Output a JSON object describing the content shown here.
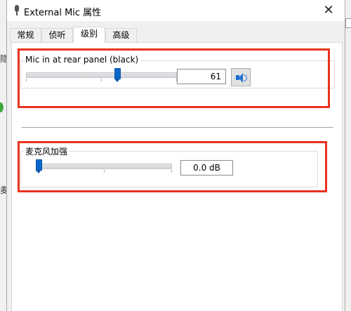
{
  "window": {
    "title": "External Mic 属性",
    "close_label": "✕"
  },
  "tabs": [
    {
      "label": "常规"
    },
    {
      "label": "侦听"
    },
    {
      "label": "级别"
    },
    {
      "label": "高级"
    }
  ],
  "active_tab": "级别",
  "mic_group": {
    "label": "Mic in at rear panel (black)",
    "value": "61",
    "level": 61
  },
  "boost_group": {
    "label": "麦克风加强",
    "value": "0.0 dB",
    "level": 0
  },
  "background": {
    "left_glyph": "隐",
    "left_glyph_2": "麦"
  },
  "colors": {
    "highlight": "#e8331e",
    "thumb": "#0a67c8"
  }
}
